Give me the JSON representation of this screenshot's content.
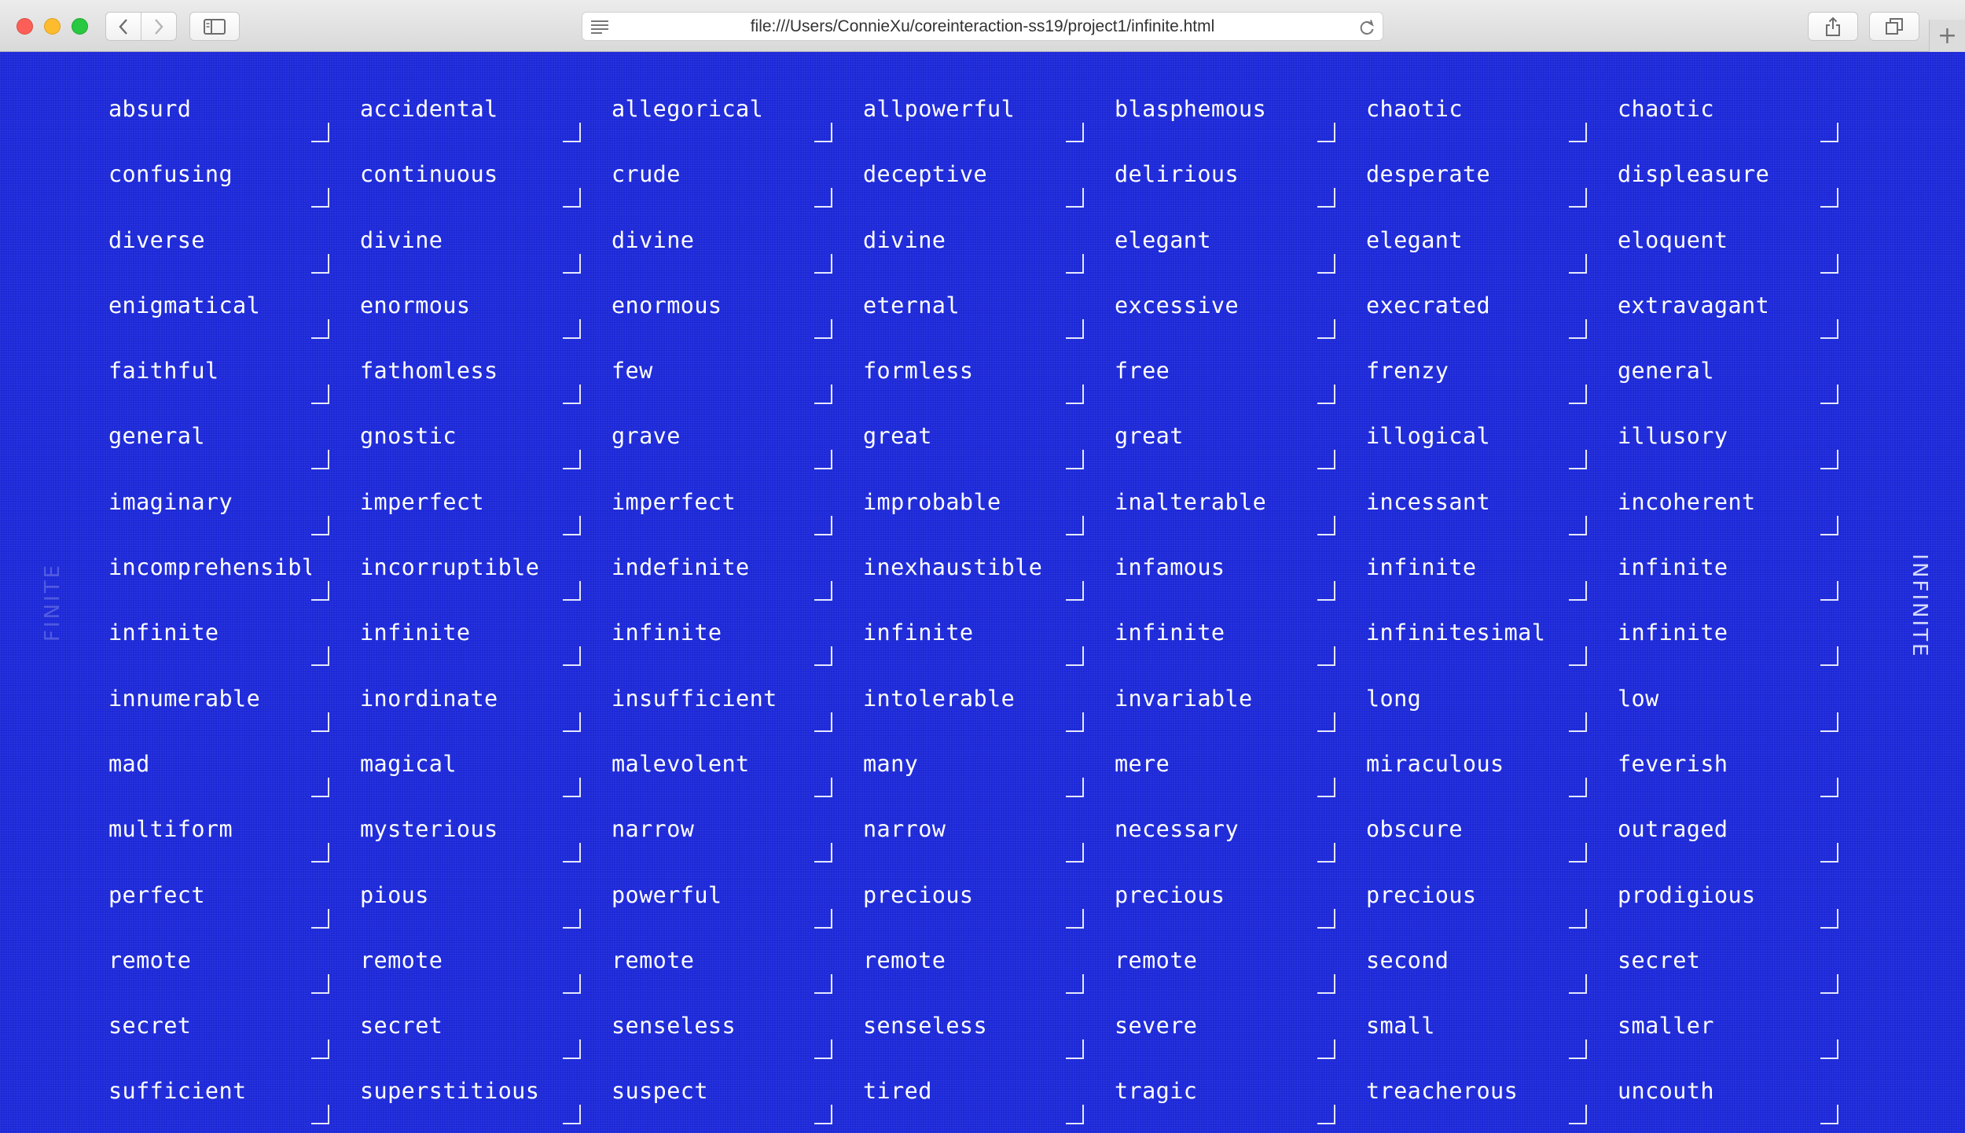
{
  "browser": {
    "url": "file:///Users/ConnieXu/coreinteraction-ss19/project1/infinite.html",
    "new_tab_label": "+"
  },
  "page": {
    "left_label": "FINITE",
    "right_label": "INFINITE",
    "background_color": "#1c28d8"
  },
  "words": [
    "absurd",
    "accidental",
    "allegorical",
    "allpowerful",
    "blasphemous",
    "chaotic",
    "chaotic",
    "confusing",
    "continuous",
    "crude",
    "deceptive",
    "delirious",
    "desperate",
    "displeasure",
    "diverse",
    "divine",
    "divine",
    "divine",
    "elegant",
    "elegant",
    "eloquent",
    "enigmatical",
    "enormous",
    "enormous",
    "eternal",
    "excessive",
    "execrated",
    "extravagant",
    "faithful",
    "fathomless",
    "few",
    "formless",
    "free",
    "frenzy",
    "general",
    "general",
    "gnostic",
    "grave",
    "great",
    "great",
    "illogical",
    "illusory",
    "imaginary",
    "imperfect",
    "imperfect",
    "improbable",
    "inalterable",
    "incessant",
    "incoherent",
    "incomprehensible",
    "incorruptible",
    "indefinite",
    "inexhaustible",
    "infamous",
    "infinite",
    "infinite",
    "infinite",
    "infinite",
    "infinite",
    "infinite",
    "infinite",
    "infinitesimal",
    "infinite",
    "innumerable",
    "inordinate",
    "insufficient",
    "intolerable",
    "invariable",
    "long",
    "low",
    "mad",
    "magical",
    "malevolent",
    "many",
    "mere",
    "miraculous",
    "feverish",
    "multiform",
    "mysterious",
    "narrow",
    "narrow",
    "necessary",
    "obscure",
    "outraged",
    "perfect",
    "pious",
    "powerful",
    "precious",
    "precious",
    "precious",
    "prodigious",
    "remote",
    "remote",
    "remote",
    "remote",
    "remote",
    "second",
    "secret",
    "secret",
    "secret",
    "senseless",
    "senseless",
    "severe",
    "small",
    "smaller",
    "sufficient",
    "superstitious",
    "suspect",
    "tired",
    "tragic",
    "treacherous",
    "uncouth"
  ]
}
